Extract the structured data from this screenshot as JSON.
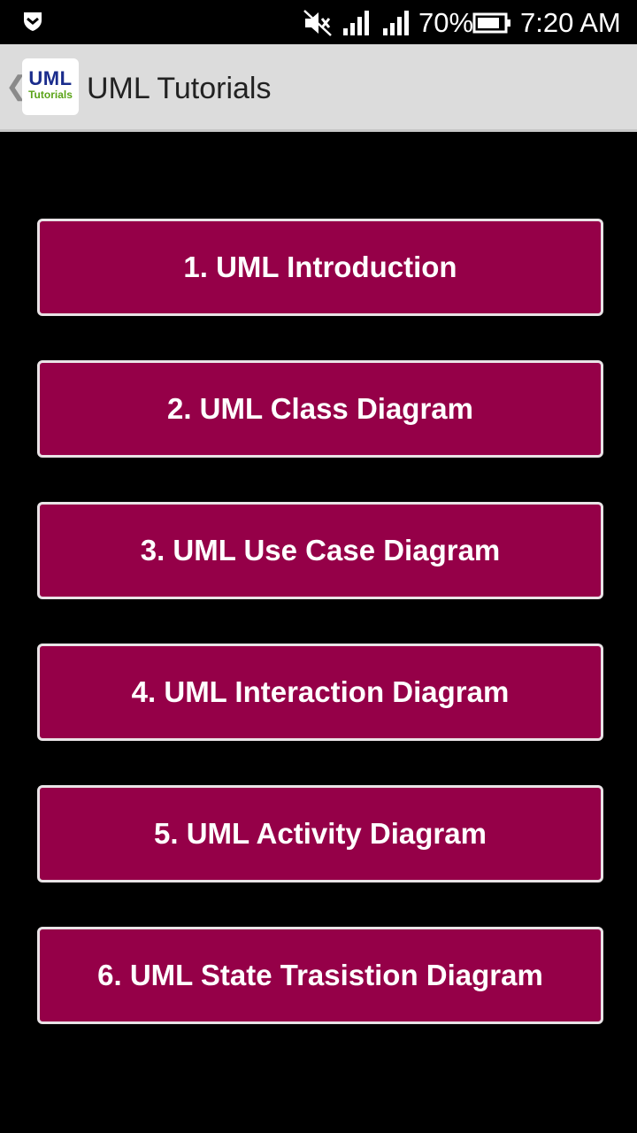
{
  "status_bar": {
    "battery_percent": "70%",
    "time": "7:20 AM",
    "icons": [
      "shield-icon",
      "mute-icon",
      "signal-icon",
      "signal-icon",
      "battery-icon"
    ]
  },
  "action_bar": {
    "back_glyph": "❮",
    "logo_text": "UML",
    "logo_subtext": "Tutorials",
    "title": "UML Tutorials"
  },
  "menu": {
    "items": [
      {
        "label": "1. UML Introduction"
      },
      {
        "label": "2. UML Class Diagram"
      },
      {
        "label": "3. UML Use Case Diagram"
      },
      {
        "label": "4. UML Interaction Diagram"
      },
      {
        "label": "5. UML Activity Diagram"
      },
      {
        "label": "6. UML State Trasistion Diagram"
      }
    ]
  },
  "colors": {
    "button_bg": "#950048",
    "button_border": "#e9e3e6",
    "action_bar_bg": "#dcdcdc",
    "background": "#000000"
  }
}
